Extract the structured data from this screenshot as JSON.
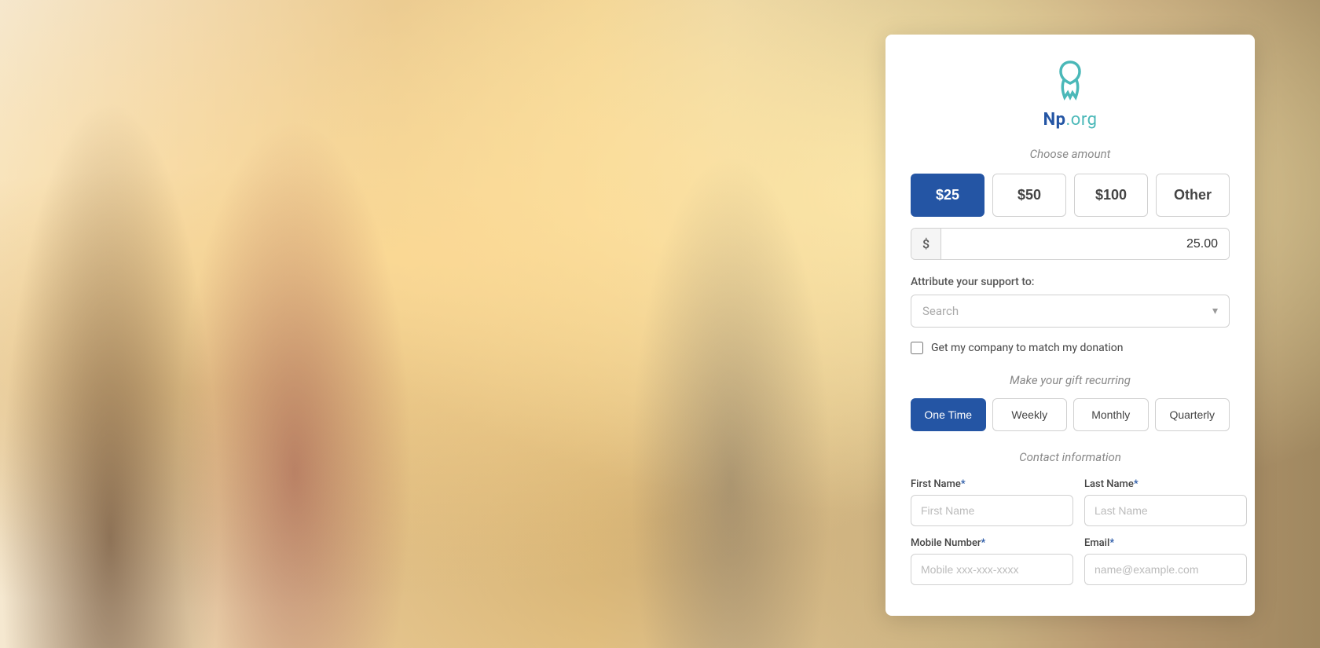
{
  "background": {
    "alt": "Group of smiling friends at a festival"
  },
  "panel": {
    "logo": {
      "text_bold": "Np",
      "text_light": ".org"
    },
    "choose_amount": {
      "label": "Choose amount",
      "amounts": [
        {
          "label": "$25",
          "value": "25",
          "active": true
        },
        {
          "label": "$50",
          "value": "50",
          "active": false
        },
        {
          "label": "$100",
          "value": "100",
          "active": false
        },
        {
          "label": "Other",
          "value": "other",
          "active": false
        }
      ],
      "input_prefix": "$",
      "input_value": "25.00"
    },
    "attribute": {
      "label": "Attribute your support to:",
      "search_placeholder": "Search",
      "chevron": "▾"
    },
    "company_match": {
      "label": "Get my company to match my donation",
      "checked": false
    },
    "recurring": {
      "label": "Make your gift recurring",
      "frequencies": [
        {
          "label": "One Time",
          "active": true
        },
        {
          "label": "Weekly",
          "active": false
        },
        {
          "label": "Monthly",
          "active": false
        },
        {
          "label": "Quarterly",
          "active": false
        }
      ]
    },
    "contact": {
      "label": "Contact information",
      "fields": {
        "first_name_label": "First Name",
        "first_name_required": "*",
        "first_name_placeholder": "First Name",
        "last_name_label": "Last Name",
        "last_name_required": "*",
        "last_name_placeholder": "Last Name",
        "mobile_label": "Mobile Number",
        "mobile_required": "*",
        "mobile_placeholder": "Mobile xxx-xxx-xxxx",
        "email_label": "Email",
        "email_required": "*",
        "email_placeholder": "name@example.com"
      }
    }
  }
}
